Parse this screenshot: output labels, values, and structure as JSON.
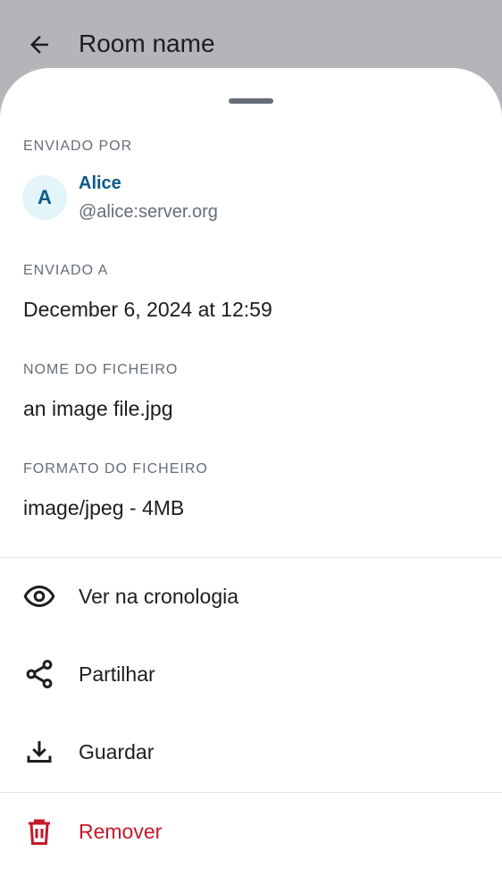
{
  "header": {
    "title": "Room name",
    "back_icon": "arrow-left-icon"
  },
  "sheet": {
    "sent_by": {
      "label": "ENVIADO POR",
      "avatar_initial": "A",
      "name": "Alice",
      "user_id": "@alice:server.org"
    },
    "sent_at": {
      "label": "ENVIADO A",
      "value": "December 6, 2024 at 12:59"
    },
    "file_name": {
      "label": "NOME DO FICHEIRO",
      "value": "an image file.jpg"
    },
    "file_format": {
      "label": "FORMATO DO FICHEIRO",
      "value": "image/jpeg - 4MB"
    },
    "actions": [
      {
        "label": "Ver na cronologia",
        "icon": "eye-icon"
      },
      {
        "label": "Partilhar",
        "icon": "share-icon"
      },
      {
        "label": "Guardar",
        "icon": "download-icon"
      },
      {
        "label": "Remover",
        "icon": "trash-icon"
      }
    ]
  },
  "colors": {
    "accent": "#0a5a88",
    "danger": "#c4192a",
    "secondary_text": "#656d77",
    "scrim": "#b3b5b8"
  }
}
